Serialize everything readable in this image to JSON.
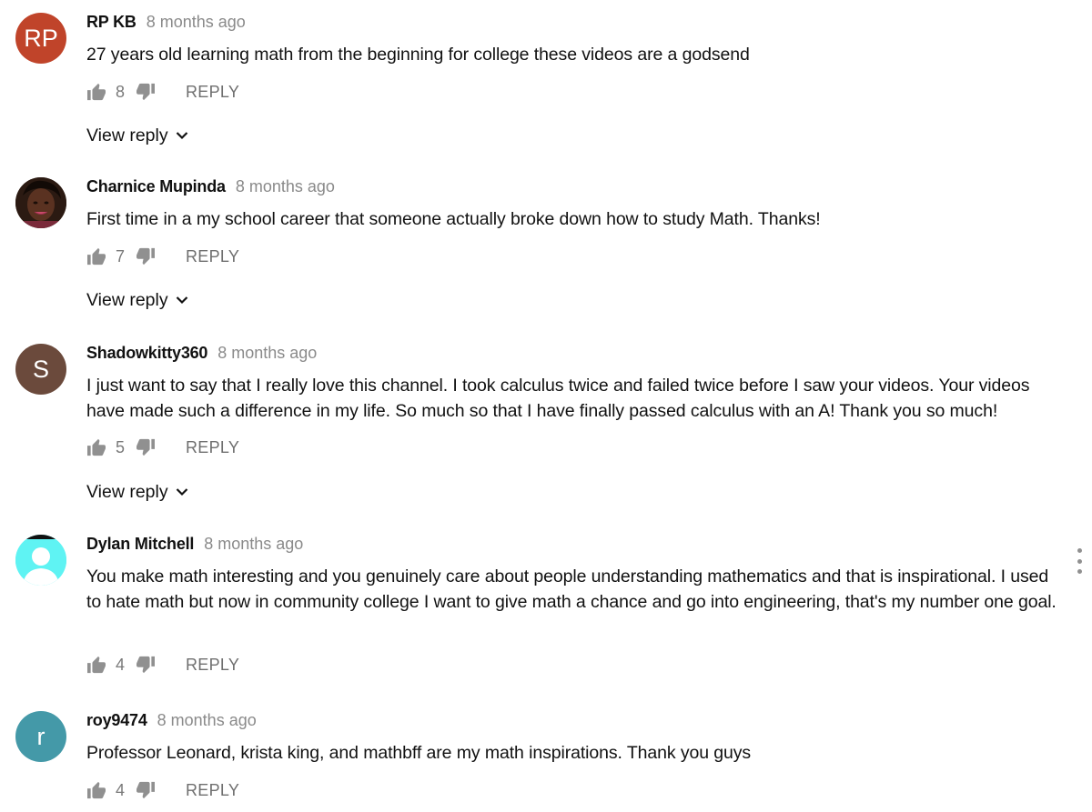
{
  "actions": {
    "reply_label": "REPLY",
    "view_reply_label": "View reply"
  },
  "comments": [
    {
      "author": "RP KB",
      "time": "8 months ago",
      "avatar_letter": "RP",
      "avatar_color": "#c0442a",
      "text": "27 years old learning math from the beginning for college these videos are a godsend",
      "likes": "8"
    },
    {
      "author": "Charnice Mupinda",
      "time": "8 months ago",
      "avatar_letter": "",
      "avatar_color": "#3a2418",
      "text": "First time in a my school career that someone actually broke down how to study Math. Thanks!",
      "likes": "7"
    },
    {
      "author": "Shadowkitty360",
      "time": "8 months ago",
      "avatar_letter": "S",
      "avatar_color": "#6b4a3c",
      "text": "I just want to say that I really love this channel. I took calculus twice and failed twice before I saw your videos. Your videos have made such a difference in my life. So much so that I have finally passed calculus with an A! Thank you so much!",
      "likes": "5"
    },
    {
      "author": "Dylan Mitchell",
      "time": "8 months ago",
      "avatar_letter": "",
      "avatar_color": "#5ff3f3",
      "text": "You make math interesting and you genuinely care about people understanding mathematics and that is inspirational. I used to hate math but now in community college I want to give math a chance and go into engineering, that's my number one goal.",
      "likes": "4"
    },
    {
      "author": "roy9474",
      "time": "8 months ago",
      "avatar_letter": "r",
      "avatar_color": "#4499a8",
      "text": "Professor Leonard, krista king, and mathbff are my math inspirations. Thank you guys",
      "likes": "4"
    }
  ],
  "icons": {
    "like": "thumb-up-icon",
    "dislike": "thumb-down-icon",
    "chevron": "chevron-down-icon",
    "menu": "more-vert-icon"
  }
}
